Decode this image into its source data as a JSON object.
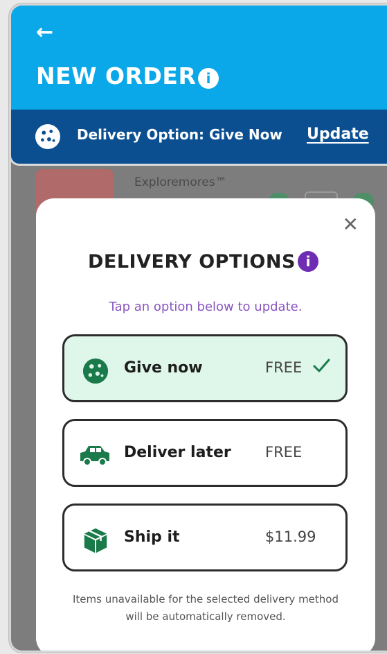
{
  "header": {
    "back_icon": "arrow-left-icon",
    "title": "NEW ORDER",
    "info_icon": "info-icon",
    "delivery_text": "Delivery Option: Give Now",
    "update_label": "Update",
    "colors": {
      "top": "#0aa8e9",
      "bar": "#0b4f91"
    }
  },
  "background_product": {
    "name": "Exploremores™"
  },
  "modal": {
    "title": "DELIVERY OPTIONS",
    "subtitle": "Tap an option below to update.",
    "options": [
      {
        "label": "Give now",
        "price": "FREE",
        "icon": "cookie-icon",
        "selected": true
      },
      {
        "label": "Deliver later",
        "price": "FREE",
        "icon": "car-icon",
        "selected": false
      },
      {
        "label": "Ship it",
        "price": "$11.99",
        "icon": "box-icon",
        "selected": false
      }
    ],
    "footnote": "Items unavailable for the selected delivery method will be automatically removed.",
    "accent_color": "#1a7a4a",
    "info_color": "#6f2db3"
  }
}
